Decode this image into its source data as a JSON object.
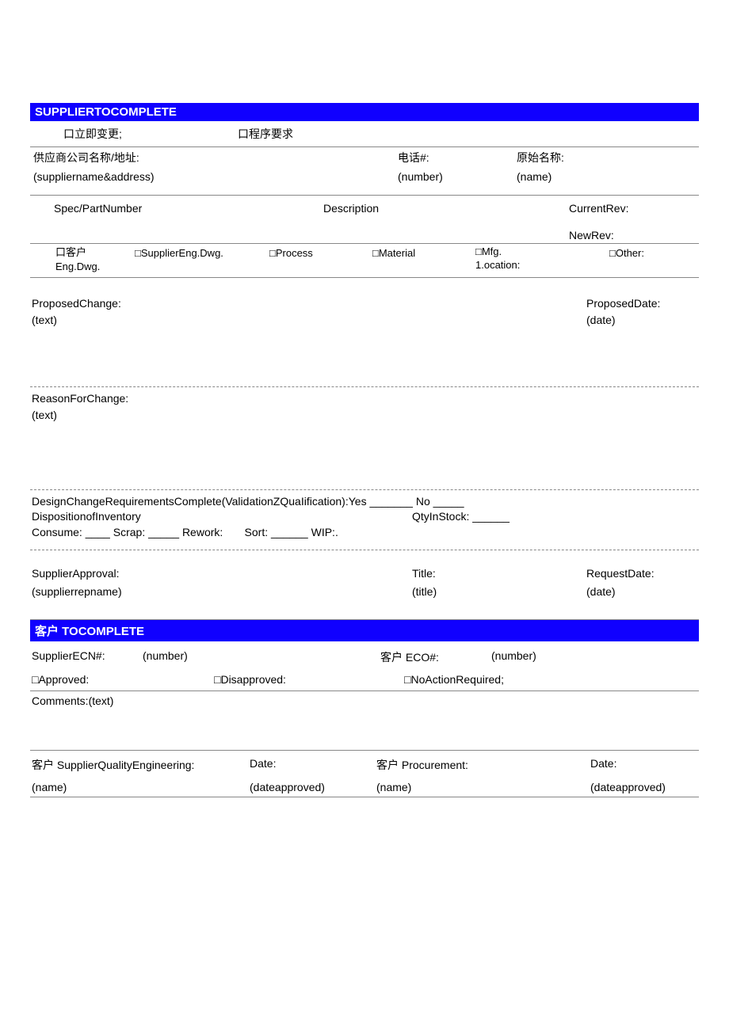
{
  "supplier_header": "SUPPLIERTOCOMPLETE",
  "change_type": {
    "immediate": "口立即变更;",
    "procedure": "口程序要求"
  },
  "supplier_info": {
    "name_addr_label": "供应商公司名称/地址:",
    "name_addr_value": "(suppliername&address)",
    "phone_label": "电话#:",
    "phone_value": "(number)",
    "orig_name_label": "原始名称:",
    "orig_name_value": "(name)"
  },
  "spec": {
    "spec_part": "Spec/PartNumber",
    "description": "Description",
    "current_rev": "CurrentRev:",
    "new_rev": "NewRev:"
  },
  "change_area": {
    "cust_eng": "口客户Eng.Dwg.",
    "cust_eng_l1": "口客户",
    "cust_eng_l2": "Eng.Dwg.",
    "supplier_eng": "□SupplierEng.Dwg.",
    "process": "□Process",
    "material": "□Material",
    "mfg_l1": "□Mfg.",
    "mfg_l2": "1.ocation:",
    "other": "□Other:"
  },
  "proposed_change": {
    "label": "ProposedChange:",
    "value": "(text)",
    "date_label": "ProposedDate:",
    "date_value": "(date)"
  },
  "reason": {
    "label": "ReasonForChange:",
    "value": "(text)"
  },
  "design_req": "DesignChangeRequirementsComplete(ValidationZQuaIification):Yes _______ No _____",
  "disposition": {
    "label": "DispositionofInventory",
    "qty_label": "QtyInStock: ______",
    "line2": "Consume: ____Scrap: _____Rework:     Sort: ______WIP:.",
    "consume": "Consume:",
    "scrap": "Scrap:",
    "rework": "Rework:",
    "sort": "Sort:",
    "wip": "WIP:."
  },
  "supplier_approval": {
    "label": "SupplierApproval:",
    "value": "(supplierrepname)",
    "title_label": "Title:",
    "title_value": "(title)",
    "date_label": "RequestDate:",
    "date_value": "(date)"
  },
  "customer_header": "客户 TOCOMPLETE",
  "ecn": {
    "supplier_ecn_label": "SupplierECN#:",
    "supplier_ecn_value": "(number)",
    "cust_eco_label": "客户 ECO#:",
    "cust_eco_value": "(number)"
  },
  "decision": {
    "approved": "□Approved:",
    "disapproved": "□Disapproved:",
    "no_action": "□NoActionRequired;"
  },
  "comments": {
    "label": "Comments:(text)"
  },
  "signatures": {
    "sq_label": "客户 SupplierQualityEngineering:",
    "sq_name": "(name)",
    "sq_date_label": "Date:",
    "sq_date_value": "(dateapproved)",
    "proc_label": "客户 Procurement:",
    "proc_name": "(name)",
    "proc_date_label": "Date:",
    "proc_date_value": "(dateapproved)"
  }
}
